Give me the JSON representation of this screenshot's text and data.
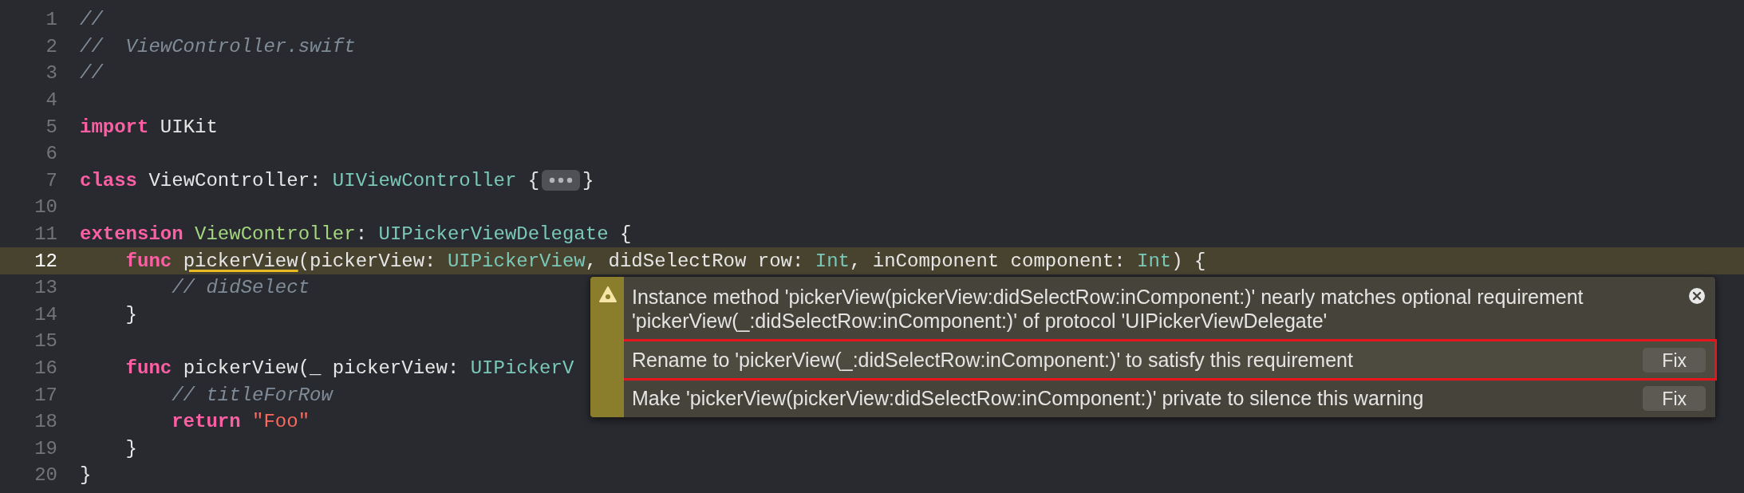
{
  "editor": {
    "lines": [
      {
        "number": "1",
        "current": false,
        "tokens": [
          {
            "text": "//",
            "kind": "comment"
          }
        ]
      },
      {
        "number": "2",
        "current": false,
        "tokens": [
          {
            "text": "//  ViewController.swift",
            "kind": "comment"
          }
        ]
      },
      {
        "number": "3",
        "current": false,
        "tokens": [
          {
            "text": "//",
            "kind": "comment"
          }
        ]
      },
      {
        "number": "4",
        "current": false
      },
      {
        "number": "5",
        "current": false,
        "tokens": [
          {
            "text": "import ",
            "kind": "keyword"
          },
          {
            "text": "UIKit",
            "kind": "plain"
          }
        ]
      },
      {
        "number": "6",
        "current": false
      },
      {
        "number": "7",
        "current": false,
        "tokens": [
          {
            "text": "class ",
            "kind": "keyword"
          },
          {
            "text": "ViewController: ",
            "kind": "plain"
          },
          {
            "text": "UIViewController",
            "kind": "type"
          },
          {
            "text": " {",
            "kind": "plain"
          },
          {
            "kind": "fold"
          },
          {
            "text": "}",
            "kind": "plain"
          }
        ]
      },
      {
        "number": "10",
        "current": false
      },
      {
        "number": "11",
        "current": false,
        "tokens": [
          {
            "text": "extension ",
            "kind": "keyword"
          },
          {
            "text": "ViewController",
            "kind": "project_type"
          },
          {
            "text": ": ",
            "kind": "plain"
          },
          {
            "text": "UIPickerViewDelegate",
            "kind": "type"
          },
          {
            "text": " {",
            "kind": "plain"
          }
        ]
      },
      {
        "number": "12",
        "current": true,
        "tokens": [
          {
            "text": "    func ",
            "kind": "keyword"
          },
          {
            "text": "pickerView",
            "kind": "plain",
            "warning": true
          },
          {
            "text": "(pickerView: ",
            "kind": "plain"
          },
          {
            "text": "UIPickerView",
            "kind": "type"
          },
          {
            "text": ", didSelectRow row: ",
            "kind": "plain"
          },
          {
            "text": "Int",
            "kind": "type"
          },
          {
            "text": ", inComponent component: ",
            "kind": "plain"
          },
          {
            "text": "Int",
            "kind": "type"
          },
          {
            "text": ") {",
            "kind": "plain"
          }
        ]
      },
      {
        "number": "13",
        "current": false,
        "tokens": [
          {
            "text": "        // didSelect",
            "kind": "comment"
          }
        ]
      },
      {
        "number": "14",
        "current": false,
        "tokens": [
          {
            "text": "    }",
            "kind": "plain"
          }
        ]
      },
      {
        "number": "15",
        "current": false
      },
      {
        "number": "16",
        "current": false,
        "tokens": [
          {
            "text": "    func ",
            "kind": "keyword"
          },
          {
            "text": "pickerView(_ pickerView: ",
            "kind": "plain"
          },
          {
            "text": "UIPickerV",
            "kind": "type"
          }
        ]
      },
      {
        "number": "17",
        "current": false,
        "tokens": [
          {
            "text": "        // titleForRow",
            "kind": "comment"
          }
        ]
      },
      {
        "number": "18",
        "current": false,
        "tokens": [
          {
            "text": "        return ",
            "kind": "keyword"
          },
          {
            "text": "\"Foo\"",
            "kind": "string"
          }
        ]
      },
      {
        "number": "19",
        "current": false,
        "tokens": [
          {
            "text": "    }",
            "kind": "plain"
          }
        ]
      },
      {
        "number": "20",
        "current": false,
        "tokens": [
          {
            "text": "}",
            "kind": "plain"
          }
        ]
      }
    ]
  },
  "issue_popover": {
    "message": "Instance method 'pickerView(pickerView:didSelectRow:inComponent:)' nearly matches optional requirement 'pickerView(_:didSelectRow:inComponent:)' of protocol 'UIPickerViewDelegate'",
    "fixes": [
      {
        "text": "Rename to 'pickerView(_:didSelectRow:inComponent:)' to satisfy this requirement",
        "button": "Fix",
        "selected": true
      },
      {
        "text": "Make 'pickerView(pickerView:didSelectRow:inComponent:)' private to silence this warning",
        "button": "Fix",
        "selected": false
      }
    ]
  }
}
